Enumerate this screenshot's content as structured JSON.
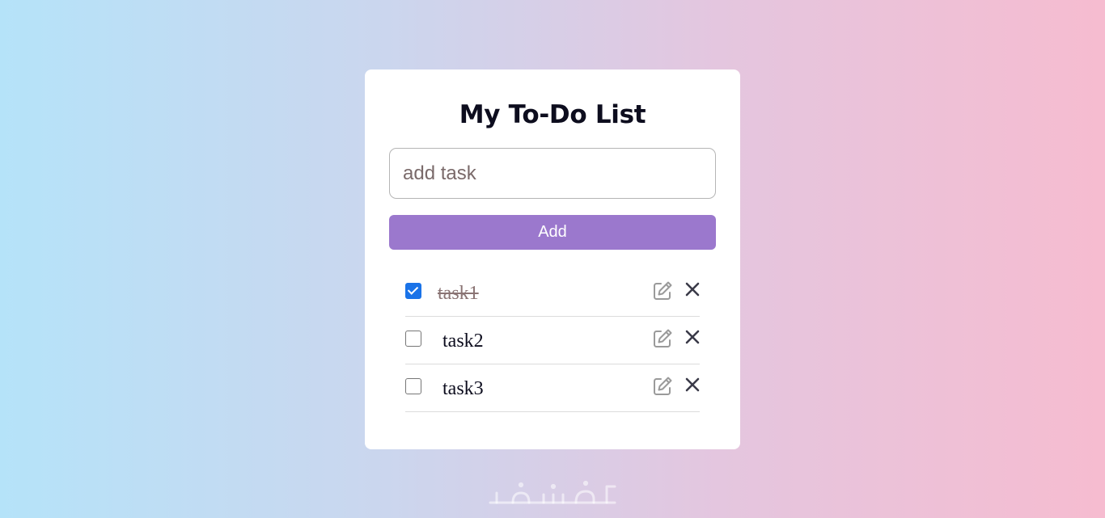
{
  "app": {
    "title": "My To-Do List"
  },
  "input": {
    "placeholder": "add task",
    "value": ""
  },
  "add_button": {
    "label": "Add"
  },
  "tasks": [
    {
      "text": "task1",
      "completed": true
    },
    {
      "text": "task2",
      "completed": false
    },
    {
      "text": "task3",
      "completed": false
    }
  ],
  "icons": {
    "edit": "edit-icon",
    "delete": "close-icon"
  },
  "watermark": {
    "text": "خمسات"
  },
  "colors": {
    "accent": "#9b78cd",
    "checkbox": "#1a73e8",
    "gradient_start": "#b5e3f9",
    "gradient_end": "#f6bcd0"
  }
}
